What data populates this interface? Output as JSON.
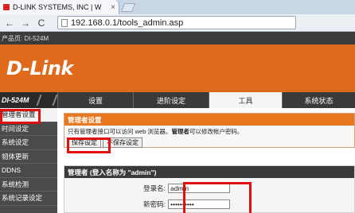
{
  "browser": {
    "tab_title": "D-LINK SYSTEMS, INC | W",
    "tab_close": "×",
    "back": "←",
    "forward": "→",
    "reload": "C",
    "url": "192.168.0.1/tools_admin.asp"
  },
  "router": {
    "product_label": "产品页: DI-524M",
    "logo": "D-Link",
    "model": "DI-524M",
    "nav_tabs": [
      "设置",
      "进阶设定",
      "工具",
      "系统状态"
    ],
    "active_tab": "工具",
    "sidebar": [
      "管理者设置",
      "时间设定",
      "系统设定",
      "韧体更新",
      "DDNS",
      "系统检测",
      "系统记录设定"
    ],
    "active_sidebar": "管理者设置"
  },
  "admin_section": {
    "title": "管理者设置",
    "desc_prefix": "只有管理者接口可以访问 web 浏览器。",
    "desc_bold": "管理者",
    "desc_suffix": "可以修改帐户密码。",
    "save_button": "保存设定",
    "nosave_button": "不保存设定"
  },
  "login_section": {
    "title": "管理者 (登入名称为 \"admin\")",
    "login_label": "登录名:",
    "login_value": "admin",
    "password_label": "新密码:",
    "password_value": "••••••••••"
  }
}
